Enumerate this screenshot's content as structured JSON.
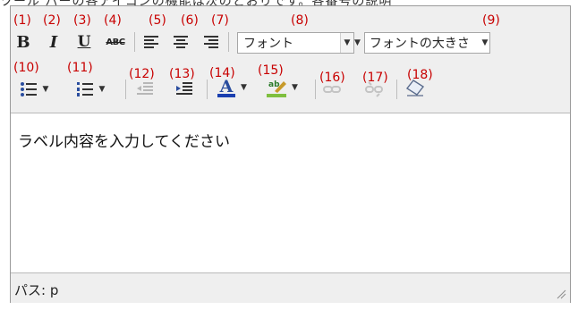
{
  "top_fragment": "ツール バーの各アイコンの機能は次のとおりです。各番号の説明",
  "toolbar": {
    "annotations": [
      "(1)",
      "(2)",
      "(3)",
      "(4)",
      "(5)",
      "(6)",
      "(7)",
      "(8)",
      "(9)",
      "(10)",
      "(11)",
      "(12)",
      "(13)",
      "(14)",
      "(15)",
      "(16)",
      "(17)",
      "(18)"
    ],
    "bold": "B",
    "italic": "I",
    "underline": "U",
    "strikethrough": "ABC",
    "font_select": "フォント",
    "size_select": "フォントの大きさ",
    "icons": {
      "align_left": "align-left-icon",
      "align_center": "align-center-icon",
      "align_right": "align-right-icon",
      "bullet_list": "bullet-list-icon",
      "numbered_list": "numbered-list-icon",
      "outdent": "outdent-icon",
      "indent": "indent-icon",
      "font_color": "font-color-icon",
      "highlight": "highlight-color-icon",
      "link": "link-icon",
      "unlink": "unlink-icon",
      "clear_format": "eraser-icon"
    }
  },
  "content": {
    "text": "ラベル内容を入力してください"
  },
  "status": {
    "path": "パス: p"
  },
  "colors": {
    "annotation": "#c80000",
    "font_color_bar": "#1a3fb0",
    "highlight_bar": "#7fbf3f"
  }
}
